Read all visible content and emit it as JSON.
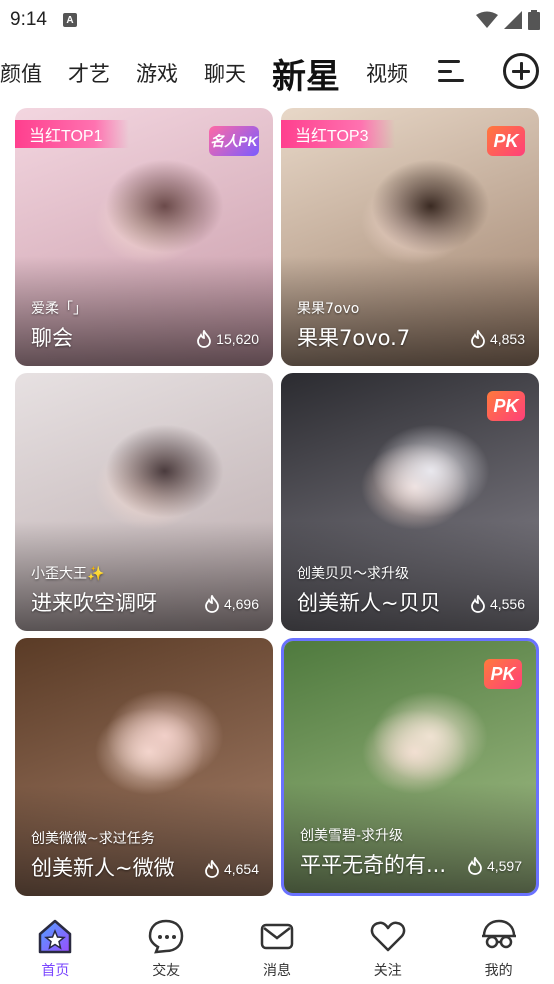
{
  "status_bar": {
    "time": "9:14",
    "notif_letter": "A"
  },
  "tabs": [
    {
      "label": "颜值"
    },
    {
      "label": "才艺"
    },
    {
      "label": "游戏"
    },
    {
      "label": "聊天"
    },
    {
      "label": "新星",
      "active": true
    },
    {
      "label": "视频"
    }
  ],
  "cards": [
    {
      "rank": "当红TOP1",
      "badge": "名人PK",
      "subtitle": "爱柔「」",
      "name": "聊会",
      "heat": "15,620",
      "colors": [
        "#f3d6e0",
        "#c79aa7",
        "#6b4a4a"
      ]
    },
    {
      "rank": "当红TOP3",
      "badge": "PK",
      "subtitle": "果果7ovo",
      "name": "果果7ovo.7",
      "heat": "4,853",
      "colors": [
        "#e8d8c8",
        "#9c7f6a",
        "#3a2a22"
      ]
    },
    {
      "rank": "",
      "badge": "",
      "subtitle": "小歪大王✨",
      "name": "进来吹空调呀",
      "heat": "4,696",
      "colors": [
        "#e7e1e2",
        "#b9a9ab",
        "#4a3b3d"
      ]
    },
    {
      "rank": "",
      "badge": "PK",
      "subtitle": "创美贝贝～求升级",
      "name": "创美新人~贝贝",
      "heat": "4,556",
      "colors": [
        "#2b2b30",
        "#8a8790",
        "#e9e8ee"
      ]
    },
    {
      "rank": "",
      "badge": "",
      "subtitle": "创美微微~求过任务",
      "name": "创美新人~微微",
      "heat": "4,654",
      "colors": [
        "#5a3b26",
        "#a7806a",
        "#f1cfc8"
      ]
    },
    {
      "rank": "",
      "badge": "PK",
      "subtitle": "创美雪碧-求升级",
      "name": "平平无奇的有...",
      "heat": "4,597",
      "colors": [
        "#4f7a3e",
        "#a6c08a",
        "#efe2d2"
      ]
    }
  ],
  "bottom_nav": [
    {
      "label": "首页",
      "icon": "home-icon",
      "active": true
    },
    {
      "label": "交友",
      "icon": "chat-bubble-icon"
    },
    {
      "label": "消息",
      "icon": "mail-icon"
    },
    {
      "label": "关注",
      "icon": "heart-icon"
    },
    {
      "label": "我的",
      "icon": "profile-glasses-icon"
    }
  ],
  "colors": {
    "accent": "#7a45ff",
    "rank_pink": "#ff3f8e"
  }
}
